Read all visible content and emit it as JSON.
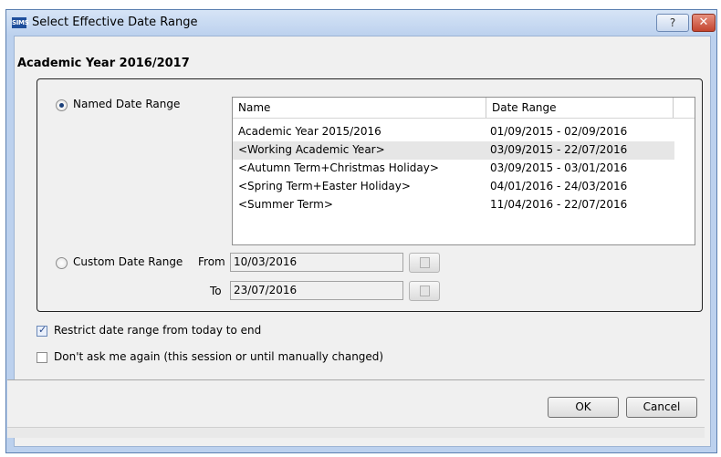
{
  "window": {
    "app_icon": "SIMS",
    "title": "Select Effective Date Range",
    "help_label": "?",
    "close_label": "✕"
  },
  "section_title": "Academic Year 2016/2017",
  "named_range": {
    "label": "Named Date Range",
    "selected": true,
    "columns": [
      "Name",
      "Date Range"
    ],
    "rows": [
      {
        "name": "Academic Year 2015/2016",
        "range": "01/09/2015 - 02/09/2016"
      },
      {
        "name": "<Working Academic Year>",
        "range": "03/09/2015 - 22/07/2016"
      },
      {
        "name": "<Autumn Term+Christmas Holiday>",
        "range": "03/09/2015 - 03/01/2016"
      },
      {
        "name": "<Spring Term+Easter Holiday>",
        "range": "04/01/2016 - 24/03/2016"
      },
      {
        "name": "<Summer Term>",
        "range": "11/04/2016 - 22/07/2016"
      }
    ]
  },
  "custom_range": {
    "label": "Custom Date Range",
    "selected": false,
    "from_label": "From",
    "from_value": "10/03/2016",
    "to_label": "To",
    "to_value": "23/07/2016",
    "calendar_icon": "calendar-icon"
  },
  "options": {
    "restrict": {
      "label": "Restrict date range from today to end",
      "checked": true
    },
    "dont_ask": {
      "label": "Don't ask me again (this session or until manually changed)",
      "checked": false
    }
  },
  "buttons": {
    "ok": "OK",
    "cancel": "Cancel"
  }
}
